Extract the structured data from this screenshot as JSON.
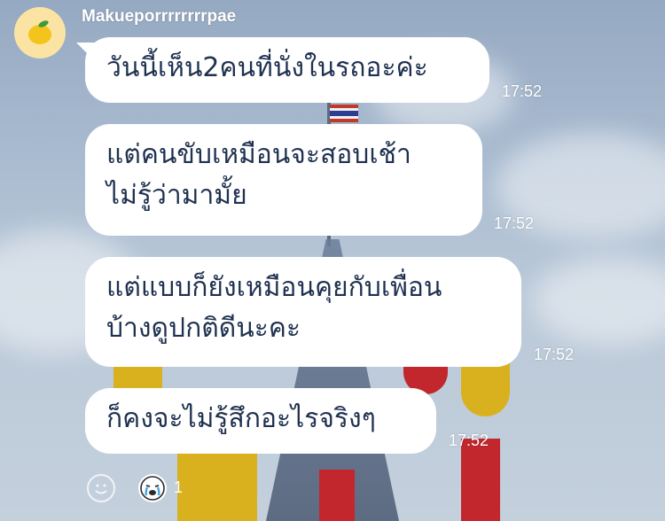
{
  "chat": {
    "sender_name": "Makueporrrrrrrrpae",
    "avatar_icon": "lemon-icon",
    "messages": [
      {
        "lines": [
          "วันนี้เห็น2คนที่นั่งในรถอะค่ะ"
        ],
        "time": "17:52"
      },
      {
        "lines": [
          "แต่คนขับเหมือนจะสอบเช้า",
          "ไม่รู้ว่ามามั้ย"
        ],
        "time": "17:52"
      },
      {
        "lines": [
          "แต่แบบก็ยังเหมือนคุยกับเพื่อน",
          "บ้างดูปกติดีนะคะ"
        ],
        "time": "17:52"
      },
      {
        "lines": [
          "ก็คงจะไม่รู้สึกอะไรจริงๆ"
        ],
        "time": "17:52"
      }
    ],
    "reaction_bar": {
      "add_reaction_icon": "smiley-outline-icon",
      "reaction_icon": "crying-face-icon",
      "reaction_count": "1"
    }
  }
}
